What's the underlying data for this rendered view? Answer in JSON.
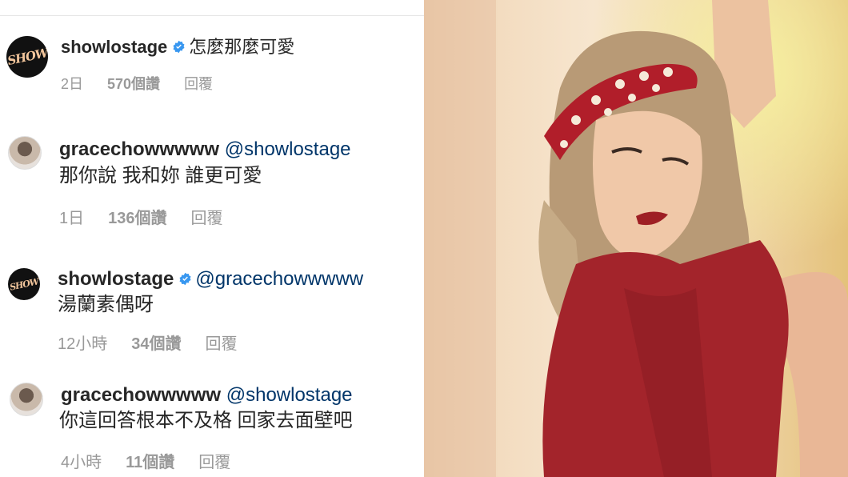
{
  "comments": [
    {
      "user": "showlostage",
      "verified": true,
      "mention": "",
      "text_inline": "怎麼那麼可愛",
      "text": "",
      "time": "2日",
      "likes": "570個讚",
      "reply": "回覆",
      "avatar": "show-logo"
    },
    {
      "user": "gracechowwwww",
      "verified": false,
      "mention": "@showlostage",
      "text_inline": "",
      "text": "那你說 我和妳 誰更可愛",
      "time": "1日",
      "likes": "136個讚",
      "reply": "回覆",
      "avatar": "profile-photo"
    },
    {
      "user": "showlostage",
      "verified": true,
      "mention": "@gracechowwwww",
      "text_inline": "",
      "text": "湯蘭素偶呀",
      "time": "12小時",
      "likes": "34個讚",
      "reply": "回覆",
      "avatar": "show-logo"
    },
    {
      "user": "gracechowwwww",
      "verified": false,
      "mention": "@showlostage",
      "text_inline": "",
      "text": "你這回答根本不及格 回家去面壁吧",
      "time": "4小時",
      "likes": "11個讚",
      "reply": "回覆",
      "avatar": "profile-photo"
    }
  ],
  "avatar_logo_text": "SHOW",
  "colors": {
    "verified": "#3897f0",
    "mention": "#003569",
    "meta": "#999999"
  }
}
